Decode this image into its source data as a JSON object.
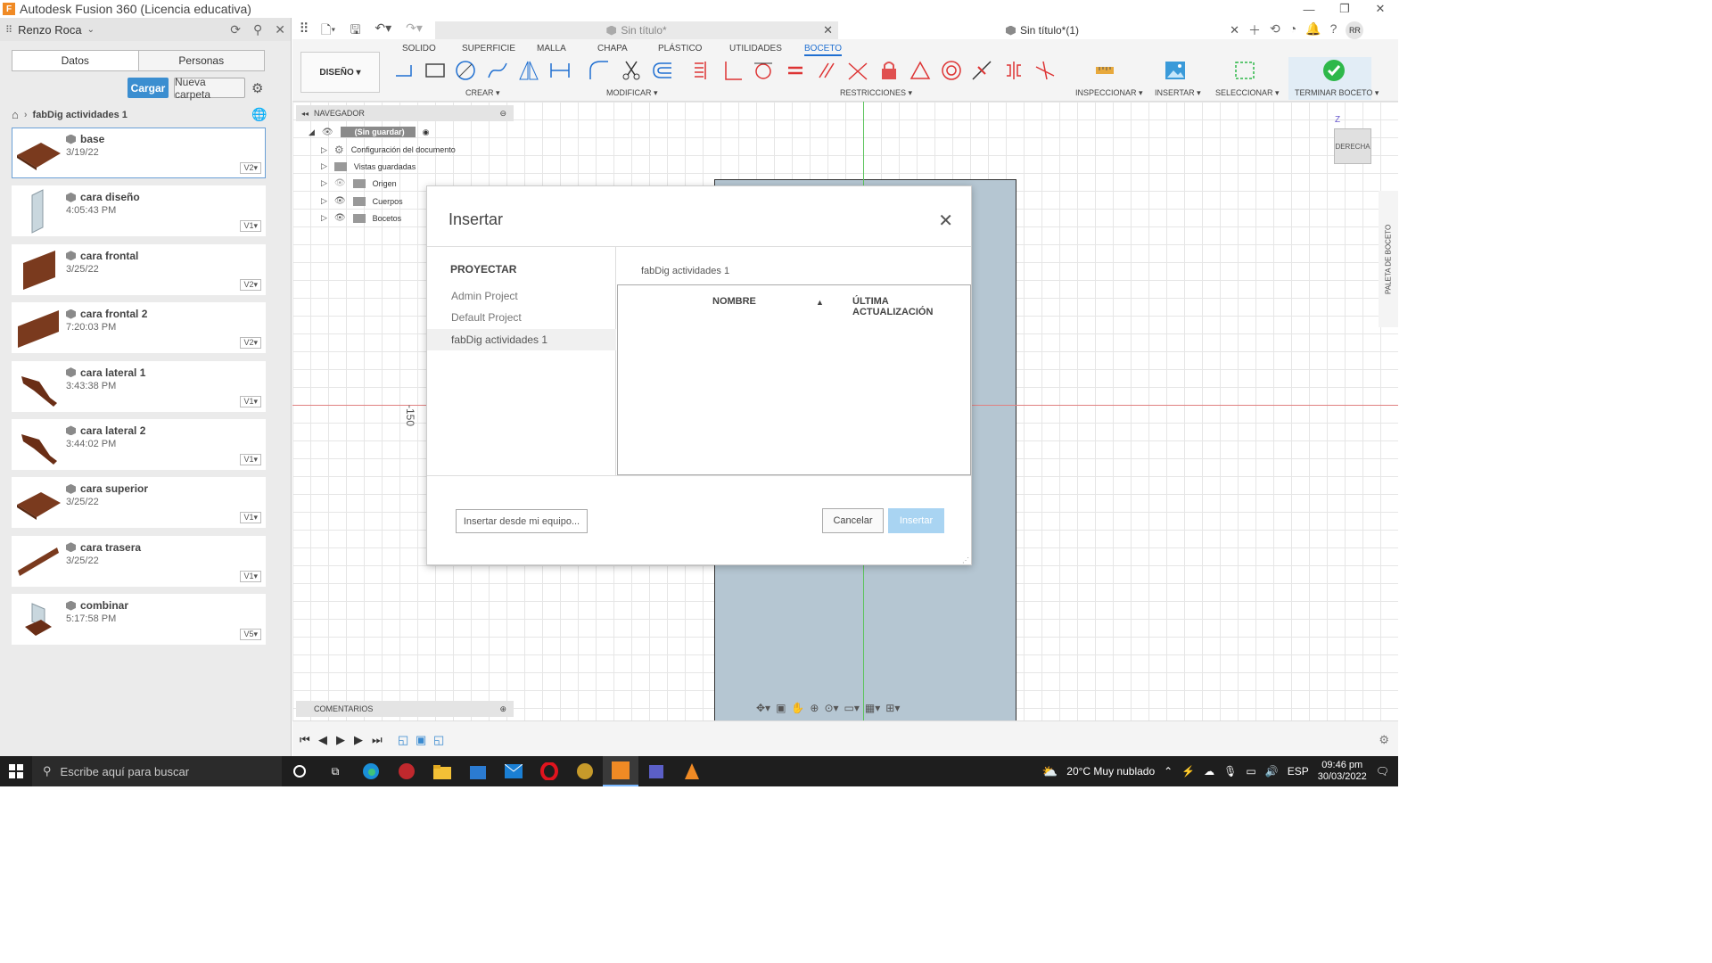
{
  "window": {
    "title": "Autodesk Fusion 360 (Licencia educativa)",
    "logo_letter": "F"
  },
  "data_panel": {
    "user": "Renzo Roca",
    "tabs": [
      "Datos",
      "Personas"
    ],
    "upload_label": "Cargar",
    "new_folder_label": "Nueva carpeta",
    "breadcrumb": "fabDig actividades 1",
    "files": [
      {
        "name": "base",
        "date": "3/19/22",
        "version": "V2▾"
      },
      {
        "name": "cara diseño",
        "date": "4:05:43 PM",
        "version": "V1▾"
      },
      {
        "name": "cara frontal",
        "date": "3/25/22",
        "version": "V2▾"
      },
      {
        "name": "cara frontal 2",
        "date": "7:20:03 PM",
        "version": "V2▾"
      },
      {
        "name": "cara lateral 1",
        "date": "3:43:38 PM",
        "version": "V1▾"
      },
      {
        "name": "cara lateral 2",
        "date": "3:44:02 PM",
        "version": "V1▾"
      },
      {
        "name": "cara superior",
        "date": "3/25/22",
        "version": "V1▾"
      },
      {
        "name": "cara trasera",
        "date": "3/25/22",
        "version": "V1▾"
      },
      {
        "name": "combinar",
        "date": "5:17:58 PM",
        "version": "V5▾"
      }
    ]
  },
  "doc_tabs": [
    {
      "label": "Sin título*"
    },
    {
      "label": "Sin título*(1)"
    }
  ],
  "user_initials": "RR",
  "toolbar": {
    "workspace": "DISEÑO ▾",
    "tabs": [
      "SOLIDO",
      "SUPERFICIE",
      "MALLA",
      "CHAPA",
      "PLÁSTICO",
      "UTILIDADES",
      "BOCETO"
    ],
    "active_tab": "BOCETO",
    "groups": {
      "create": "CREAR ▾",
      "modify": "MODIFICAR ▾",
      "constraints": "RESTRICCIONES ▾",
      "inspect": "INSPECCIONAR ▾",
      "insert": "INSERTAR ▾",
      "select": "SELECCIONAR ▾",
      "finish": "TERMINAR BOCETO ▾"
    }
  },
  "browser": {
    "title": "NAVEGADOR",
    "root": "(Sin guardar)",
    "items": [
      "Configuración del documento",
      "Vistas guardadas",
      "Origen",
      "Cuerpos",
      "Bocetos"
    ],
    "comments": "COMENTARIOS"
  },
  "canvas": {
    "axis_label": "-150",
    "viewcube_label": "DERECHA",
    "viewcube_axis": "Z",
    "palette_label": "PALETA DE BOCETO"
  },
  "dialog": {
    "title": "Insertar",
    "projects_header": "PROYECTAR",
    "projects": [
      "Admin Project",
      "Default Project",
      "fabDig actividades 1"
    ],
    "selected_project": "fabDig actividades 1",
    "folder": "fabDig actividades 1",
    "columns": {
      "name": "NOMBRE",
      "updated": "ÚLTIMA ACTUALIZACIÓN"
    },
    "insert_from_pc": "Insertar desde mi equipo...",
    "cancel": "Cancelar",
    "insert": "Insertar"
  },
  "taskbar": {
    "search_placeholder": "Escribe aquí para buscar",
    "weather": "20°C  Muy nublado",
    "lang": "ESP",
    "time": "09:46 pm",
    "date": "30/03/2022"
  },
  "colors": {
    "accent": "#1f6fd1",
    "upload_button": "#3b8ed0",
    "finish_check": "#2eb84a",
    "sketch_fill": "#b5c6d2",
    "insert_disabled": "#a9d4f2"
  }
}
